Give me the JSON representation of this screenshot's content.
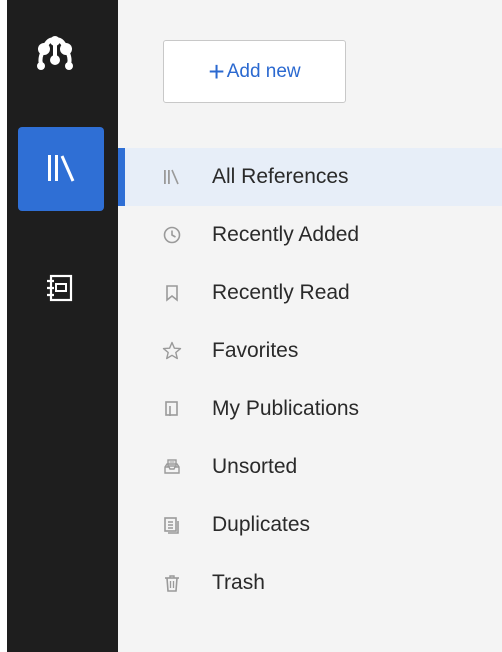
{
  "app": {
    "name": "Mendeley"
  },
  "rail": {
    "items": [
      {
        "icon": "library-icon",
        "active": true
      },
      {
        "icon": "notebook-icon",
        "active": false
      }
    ]
  },
  "add_button": {
    "plus": "+",
    "label": "Add new"
  },
  "nav": {
    "items": [
      {
        "label": "All References",
        "icon": "library-icon",
        "active": true
      },
      {
        "label": "Recently Added",
        "icon": "clock-icon"
      },
      {
        "label": "Recently Read",
        "icon": "bookmark-icon"
      },
      {
        "label": "Favorites",
        "icon": "star-icon"
      },
      {
        "label": "My Publications",
        "icon": "publications-icon"
      },
      {
        "label": "Unsorted",
        "icon": "tray-icon"
      },
      {
        "label": "Duplicates",
        "icon": "duplicates-icon"
      },
      {
        "label": "Trash",
        "icon": "trash-icon"
      }
    ]
  },
  "colors": {
    "accent": "#2f6fd5",
    "rail_bg": "#1e1e1e",
    "panel_bg": "#f4f4f4",
    "active_row_bg": "#e7eef8",
    "icon_gray": "#9a9a9a"
  }
}
